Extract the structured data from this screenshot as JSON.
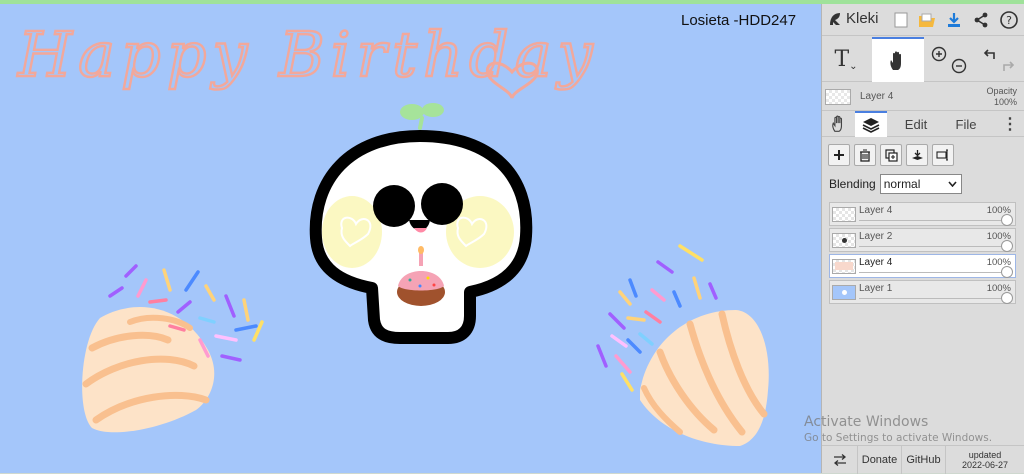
{
  "canvas": {
    "greeting": "Happy Birthday",
    "signature": "Losieta -HDD247",
    "background_color": "#a4c6fa"
  },
  "app": {
    "name": "Kleki",
    "top_icons": [
      "new-image-icon",
      "open-folder-icon",
      "download-icon",
      "share-icon",
      "help-icon"
    ]
  },
  "toolbar": {
    "text_tool_label": "T",
    "tools": [
      "text-tool-icon",
      "hand-tool-icon",
      "zoom-in-icon",
      "zoom-out-icon",
      "undo-icon",
      "redo-icon"
    ]
  },
  "current_layer": {
    "name": "Layer 4",
    "opacity_label": "Opacity",
    "opacity_value": "100%"
  },
  "tabs": {
    "edit": "Edit",
    "file": "File"
  },
  "layers_panel": {
    "blending_label": "Blending",
    "blending_value": "normal",
    "layers": [
      {
        "name": "Layer 4",
        "opacity": "100%",
        "active": false
      },
      {
        "name": "Layer 2",
        "opacity": "100%",
        "active": false
      },
      {
        "name": "Layer 4",
        "opacity": "100%",
        "active": true
      },
      {
        "name": "Layer 1",
        "opacity": "100%",
        "active": false
      }
    ]
  },
  "footer": {
    "donate": "Donate",
    "github": "GitHub",
    "updated_label": "updated",
    "updated_date": "2022-06-27"
  },
  "os_watermark": {
    "line1": "Activate Windows",
    "line2": "Go to Settings to activate Windows."
  }
}
